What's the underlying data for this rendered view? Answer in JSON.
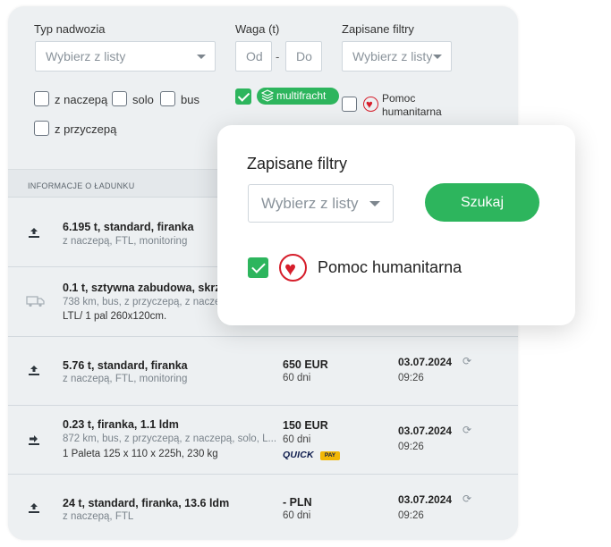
{
  "filters": {
    "body_type": {
      "label": "Typ nadwozia",
      "placeholder": "Wybierz z listy"
    },
    "weight": {
      "label": "Waga (t)",
      "from_placeholder": "Od",
      "separator": "-",
      "to_placeholder": "Do"
    },
    "saved_filters": {
      "label": "Zapisane filtry",
      "placeholder": "Wybierz z listy"
    },
    "checkboxes": [
      {
        "label": "z naczepą",
        "checked": false
      },
      {
        "label": "solo",
        "checked": false
      },
      {
        "label": "bus",
        "checked": false
      },
      {
        "label": "z przyczepą",
        "checked": false
      }
    ],
    "multifracht": {
      "label": "multifracht",
      "checked": true
    },
    "humanitarian": {
      "label_line1": "Pomoc",
      "label_line2": "humanitarna",
      "checked": false
    }
  },
  "table": {
    "header": "INFORMACJE O ŁADUNKU",
    "rows": [
      {
        "icon": "load-up-icon",
        "title": "6.195 t, standard, firanka",
        "sub": "z naczepą, FTL, monitoring"
      },
      {
        "icon": "truck-icon",
        "title": "0.1 t, sztywna zabudowa, skrz",
        "sub": "738 km, bus, z przyczepą, z nacze",
        "extra": "LTL/ 1 pal 260x120cm."
      },
      {
        "icon": "load-up-icon",
        "title": "5.76 t, standard, firanka",
        "sub": "z naczepą, FTL, monitoring",
        "price": "650 EUR",
        "days": "60 dni",
        "date": "03.07.2024",
        "time": "09:26"
      },
      {
        "icon": "load-right-icon",
        "title": "0.23 t, firanka, 1.1 ldm",
        "sub": "872 km, bus, z przyczepą, z naczepą, solo, L...",
        "extra": "1 Paleta 125 x 110 x 225h, 230 kg",
        "price": "150 EUR",
        "days": "60 dni",
        "date": "03.07.2024",
        "time": "09:26",
        "quickpay": {
          "text": "QUICK",
          "badge": "PAY"
        }
      },
      {
        "icon": "load-up-icon",
        "title": "24 t, standard, firanka, 13.6 ldm",
        "sub": "z naczepą, FTL",
        "price": "- PLN",
        "days": "60 dni",
        "date": "03.07.2024",
        "time": "09:26"
      }
    ]
  },
  "popup": {
    "title": "Zapisane filtry",
    "select_placeholder": "Wybierz z listy",
    "search_label": "Szukaj",
    "humanitarian_label": "Pomoc humanitarna",
    "humanitarian_checked": true
  },
  "colors": {
    "accent": "#2db55d",
    "heart": "#d61e2b",
    "panel_bg": "#edf0f2"
  }
}
